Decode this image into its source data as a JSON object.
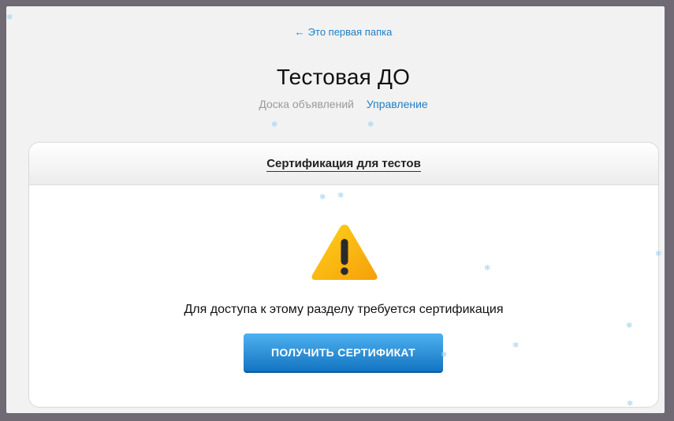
{
  "nav": {
    "back_label": "Это первая папка"
  },
  "header": {
    "title": "Тестовая ДО",
    "tabs": [
      {
        "label": "Доска объявлений",
        "active": false
      },
      {
        "label": "Управление",
        "active": true
      }
    ]
  },
  "card": {
    "title": "Сертификация для тестов",
    "message": "Для доступа к этому разделу требуется сертификация",
    "button_label": "ПОЛУЧИТЬ СЕРТИФИКАТ",
    "icon": "warning-icon"
  },
  "colors": {
    "link": "#1f7fc4",
    "button_top": "#4eb1ef",
    "button_bottom": "#1474c2",
    "warning_yellow": "#ffc107",
    "frame": "#6f6a73"
  }
}
